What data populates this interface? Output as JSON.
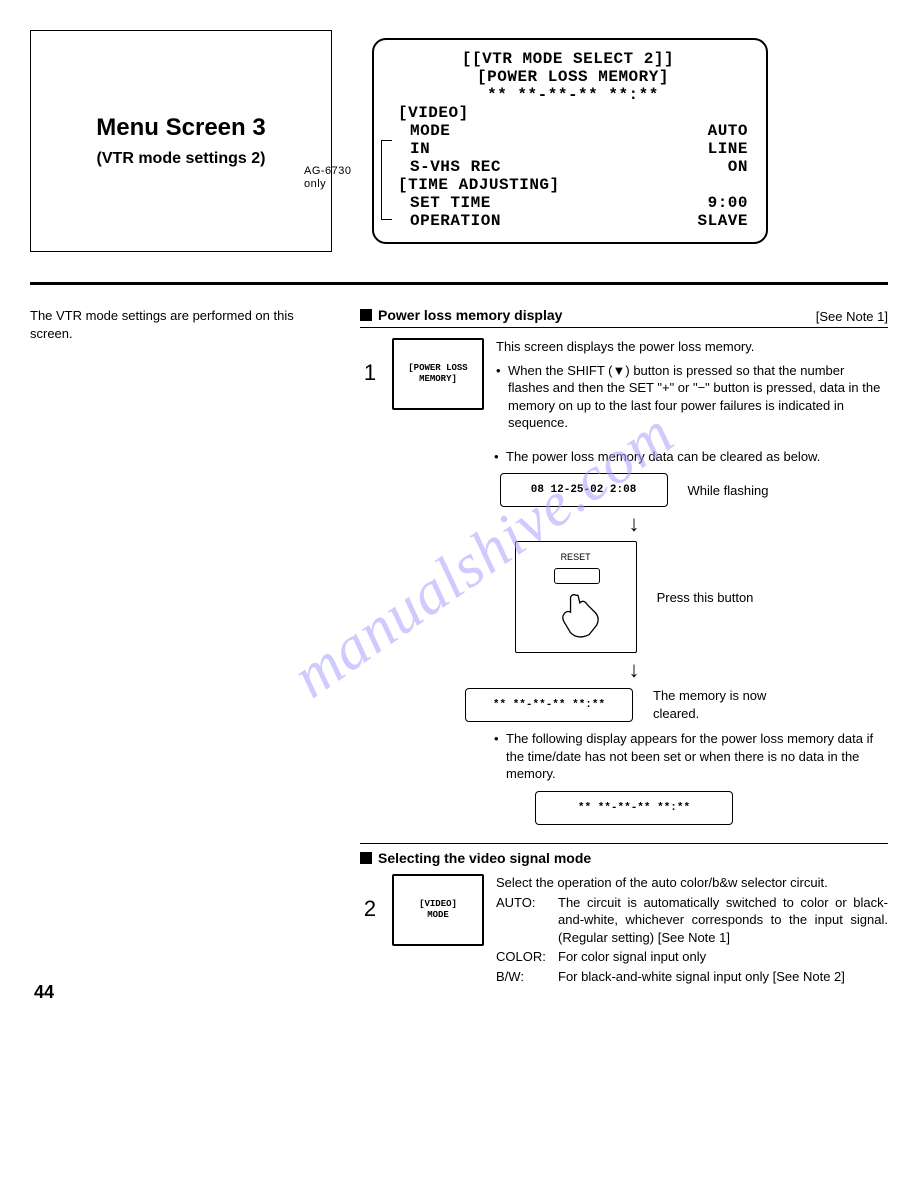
{
  "title_box": {
    "title": "Menu Screen 3",
    "subtitle": "(VTR mode settings 2)"
  },
  "menu": {
    "line1": "[[VTR MODE SELECT 2]]",
    "line2": "[POWER LOSS MEMORY]",
    "line3": "** **-**-** **:**",
    "line4": "[VIDEO]",
    "mode_l": "MODE",
    "mode_v": "AUTO",
    "in_l": "IN",
    "in_v": "LINE",
    "svhs_l": "S-VHS REC",
    "svhs_v": "ON",
    "line8": "[TIME ADJUSTING]",
    "set_l": "SET TIME",
    "set_v": "9:00",
    "op_l": "OPERATION",
    "op_v": "SLAVE",
    "note": "AG-6730 only"
  },
  "intro": "The VTR mode settings are performed on this screen.",
  "sec1": {
    "title": "Power loss memory display",
    "noteref": "[See Note 1]",
    "step_num": "1",
    "mini": "[POWER LOSS\nMEMORY]",
    "line_a": "This screen displays the power loss memory.",
    "bullet1": "When the SHIFT (▼) button is pressed so that the number flashes and then the SET \"+\" or \"−\" button is pressed, data in the memory on up to the last four power failures is indicated in sequence.",
    "bullet2": "The power loss memory data can be cleared as below.",
    "box1": "08 12-25-02  2:08",
    "cap1": "While flashing",
    "reset_label": "RESET",
    "cap2": "Press this button",
    "box3": "**  **-**-**  **:**",
    "cap3": "The memory is now cleared.",
    "bullet3": "The following display appears for the power loss memory data if the time/date has not been set or when there is no data in the memory.",
    "box4": "**  **-**-**  **:**"
  },
  "sec2": {
    "title": "Selecting the video signal mode",
    "step_num": "2",
    "mini": "[VIDEO]\nMODE",
    "intro": "Select the operation of the auto color/b&w selector circuit.",
    "auto_l": "AUTO:",
    "auto_t": "The circuit is automatically switched to color or black-and-white, whichever corresponds to the input signal. (Regular setting) [See Note 1]",
    "color_l": "COLOR:",
    "color_t": "For color signal input only",
    "bw_l": "B/W:",
    "bw_t": "For black-and-white signal input only [See Note 2]"
  },
  "watermark": "manualshive.com",
  "page": "44"
}
